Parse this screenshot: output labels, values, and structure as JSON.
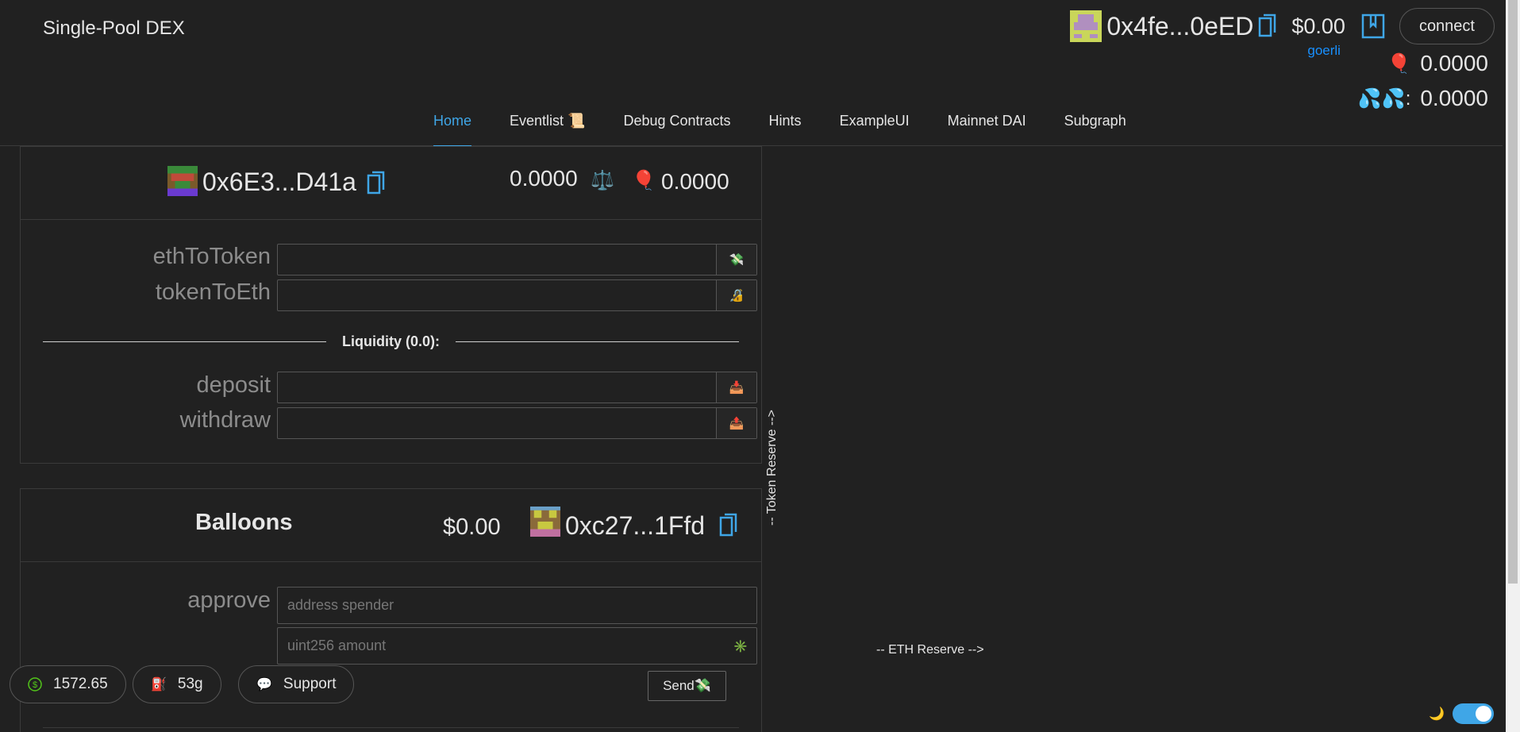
{
  "app": {
    "title": "Single-Pool DEX"
  },
  "account": {
    "address": "0x4fe...0eED",
    "usd_balance": "$0.00",
    "network": "goerli",
    "connect_label": "connect",
    "balloon_balance": "0.0000",
    "faucet_balance": "0.0000"
  },
  "nav": {
    "tabs": [
      {
        "label": "Home"
      },
      {
        "label": "Eventlist 📜"
      },
      {
        "label": "Debug Contracts"
      },
      {
        "label": "Hints"
      },
      {
        "label": "ExampleUI"
      },
      {
        "label": "Mainnet DAI"
      },
      {
        "label": "Subgraph"
      }
    ],
    "active": "Home"
  },
  "dex": {
    "address": "0x6E3...D41a",
    "eth_balance": "0.0000",
    "token_balance": "0.0000",
    "fields": [
      {
        "label": "ethToToken",
        "value": "",
        "icon": "💸"
      },
      {
        "label": "tokenToEth",
        "value": "",
        "icon": "🔏"
      }
    ],
    "liquidity_label": "Liquidity (0.0):",
    "liquidity_fields": [
      {
        "label": "deposit",
        "value": "",
        "icon": "📥"
      },
      {
        "label": "withdraw",
        "value": "",
        "icon": "📤"
      }
    ]
  },
  "balloons": {
    "title": "Balloons",
    "usd": "$0.00",
    "address": "0xc27...1Ffd",
    "approve_label": "approve",
    "spender_placeholder": "address spender",
    "amount_placeholder": "uint256 amount",
    "amount_icon": "✳️",
    "send_label": "Send💸"
  },
  "chart": {
    "token_reserve_label": "-- Token Reserve -->",
    "eth_reserve_label": "-- ETH Reserve -->"
  },
  "footer": {
    "eth_price": "1572.65",
    "gas": "53g",
    "support_label": "Support"
  },
  "icons": {
    "balloon": "🎈",
    "scale": "⚖️",
    "faucet": "💦",
    "dollar": "$",
    "fuel": "⛽",
    "chat": "💬",
    "moon": "🌙"
  },
  "colors": {
    "accent": "#3fa6e7",
    "network": "#1890ff",
    "background": "#212121"
  }
}
